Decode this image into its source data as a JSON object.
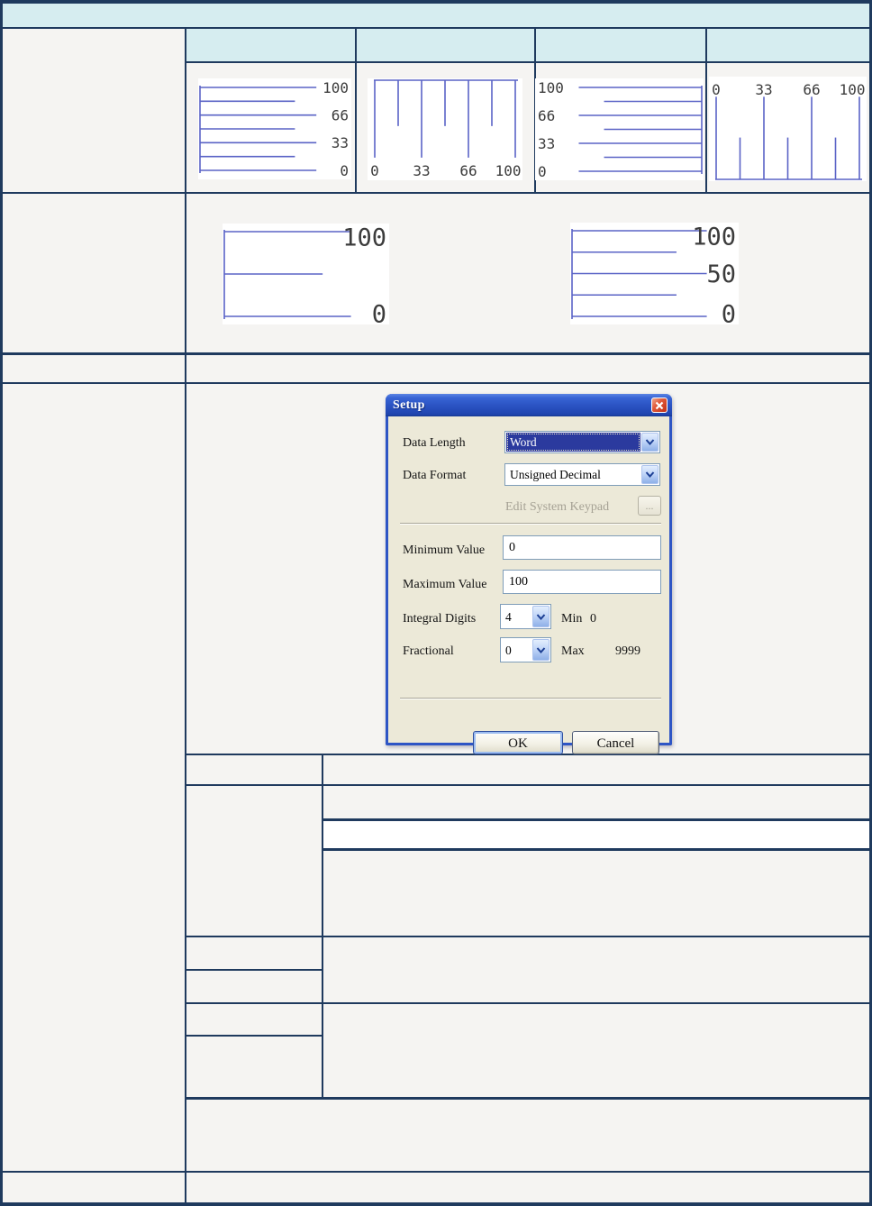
{
  "page": {
    "colors": {
      "background": "#f5f4f2",
      "table_border": "#1f3a5e",
      "header_fill": "#d6edf0",
      "highlight_row_fill": "#ffffff",
      "scale_line": "#5a63c6",
      "scale_label": "#3c3c3c",
      "dialog_body": "#ece9d8",
      "dialog_frame": "#2e55c5",
      "titlebar_blue": "#2a52c2",
      "close_button_red": "#d6482e",
      "selection_blue": "#2b3a9e"
    }
  },
  "scales": {
    "line_color": "#5a63c6",
    "label_color": "#3c3c3c",
    "items": [
      {
        "name": "vertical-scale-labels-right",
        "orient": "v",
        "spine": "left",
        "labelSide": "right",
        "font": 16,
        "pad": 10,
        "major": 0.76,
        "minor": 0.62,
        "ticks": [
          {
            "label": "100"
          },
          {},
          {
            "label": "66"
          },
          {},
          {
            "label": "33"
          },
          {},
          {
            "label": "0"
          }
        ]
      },
      {
        "name": "horizontal-scale-labels-bottom",
        "orient": "h",
        "spine": "top",
        "labelSide": "bottom",
        "font": 16,
        "major": 0.76,
        "minor": 0.45,
        "ticks": [
          {
            "label": "0"
          },
          {},
          {
            "label": "33"
          },
          {},
          {
            "label": "66"
          },
          {},
          {
            "label": "100"
          }
        ]
      },
      {
        "name": "vertical-scale-labels-left",
        "orient": "v",
        "spine": "right",
        "labelSide": "left",
        "font": 16,
        "pad": 10,
        "major": 0.73,
        "minor": 0.58,
        "ticks": [
          {
            "label": "100"
          },
          {},
          {
            "label": "66"
          },
          {},
          {
            "label": "33"
          },
          {},
          {
            "label": "0"
          }
        ]
      },
      {
        "name": "horizontal-scale-labels-top",
        "orient": "h",
        "spine": "bottom",
        "labelSide": "top",
        "font": 16,
        "major": 0.79,
        "minor": 0.4,
        "ticks": [
          {
            "label": "0"
          },
          {},
          {
            "label": "33"
          },
          {},
          {
            "label": "66"
          },
          {},
          {
            "label": "100"
          }
        ]
      },
      {
        "name": "large-vertical-scale-2-divisions",
        "orient": "v",
        "spine": "left",
        "labelSide": "right",
        "font": 27,
        "pad": 9,
        "major": 0.76,
        "minor": 0.59,
        "ticks": [
          {
            "label": "100"
          },
          {},
          {
            "label": "0"
          }
        ]
      },
      {
        "name": "large-vertical-scale-4-divisions",
        "orient": "v",
        "spine": "left",
        "labelSide": "right",
        "font": 27,
        "pad": 9,
        "major": 0.8,
        "minor": 0.62,
        "ticks": [
          {
            "label": "100"
          },
          {},
          {
            "label": "50"
          },
          {},
          {
            "label": "0"
          }
        ]
      }
    ]
  },
  "dialog": {
    "title": "Setup",
    "fields": {
      "data_length": {
        "label": "Data Length",
        "value": "Word"
      },
      "data_format": {
        "label": "Data Format",
        "value": "Unsigned Decimal"
      },
      "edit_keypad": {
        "label": "Edit System Keypad",
        "button_label": "..."
      },
      "minimum": {
        "label": "Minimum Value",
        "value": "0"
      },
      "maximum": {
        "label": "Maximum Value",
        "value": "100"
      },
      "integral": {
        "label": "Integral Digits",
        "value": "4",
        "hint_label": "Min",
        "hint_value": "0"
      },
      "fractional": {
        "label": "Fractional",
        "value": "0",
        "hint_label": "Max",
        "hint_value": "9999"
      }
    },
    "buttons": {
      "ok": "OK",
      "cancel": "Cancel"
    }
  }
}
